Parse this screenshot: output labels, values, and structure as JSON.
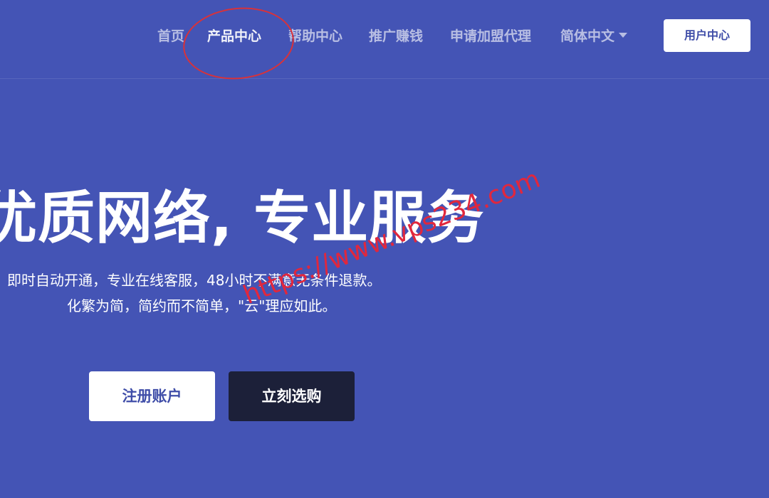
{
  "nav": {
    "items": [
      {
        "label": "首页"
      },
      {
        "label": "产品中心"
      },
      {
        "label": "帮助中心"
      },
      {
        "label": "推广赚钱"
      },
      {
        "label": "申请加盟代理"
      },
      {
        "label": "简体中文"
      }
    ],
    "user_center_label": "用户中心"
  },
  "hero": {
    "title": "优质网络, 专业服务",
    "line1": "即时自动开通，专业在线客服，48小时不满意无条件退款。",
    "line2": "化繁为简，简约而不简单，\"云\"理应如此。",
    "register_label": "注册账户",
    "buy_label": "立刻选购"
  },
  "watermark": "https://www.vps234.com",
  "colors": {
    "background": "#4454b5",
    "button_dark": "#1c2039",
    "button_light": "#ffffff",
    "watermark": "#e1273d",
    "annotation": "#d8323a"
  }
}
